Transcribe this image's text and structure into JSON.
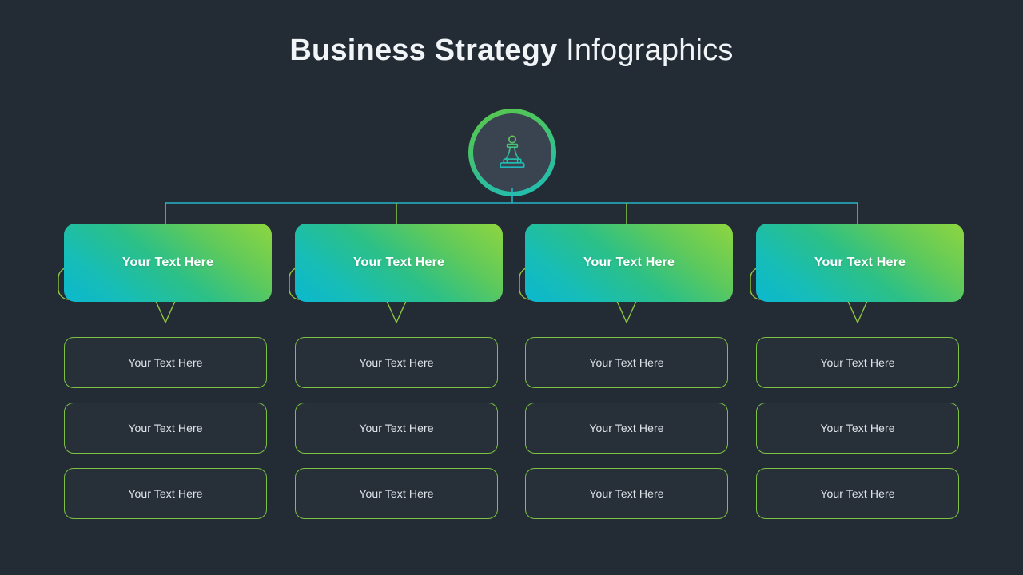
{
  "title": {
    "bold_part": "Business Strategy",
    "light_part": "Infographics"
  },
  "hub": {
    "icon": "chess-pawn-icon"
  },
  "colors": {
    "background": "#232c35",
    "accent_green": "#7dc242",
    "accent_bright_green": "#8fd63f",
    "accent_teal": "#0bb8cf",
    "connector_teal": "#25b4c4",
    "connector_green": "#7dc242",
    "header_text": "#ffffff",
    "body_text": "#dfe5ea",
    "sub_box_fill": "#272f39",
    "hub_inner_fill": "#3a4450"
  },
  "columns": [
    {
      "header": "Your Text Here",
      "items": [
        "Your Text Here",
        "Your Text Here",
        "Your Text Here"
      ]
    },
    {
      "header": "Your Text Here",
      "items": [
        "Your Text Here",
        "Your Text Here",
        "Your Text Here"
      ]
    },
    {
      "header": "Your Text Here",
      "items": [
        "Your Text Here",
        "Your Text Here",
        "Your Text Here"
      ]
    },
    {
      "header": "Your Text Here",
      "items": [
        "Your Text Here",
        "Your Text Here",
        "Your Text Here"
      ]
    }
  ]
}
